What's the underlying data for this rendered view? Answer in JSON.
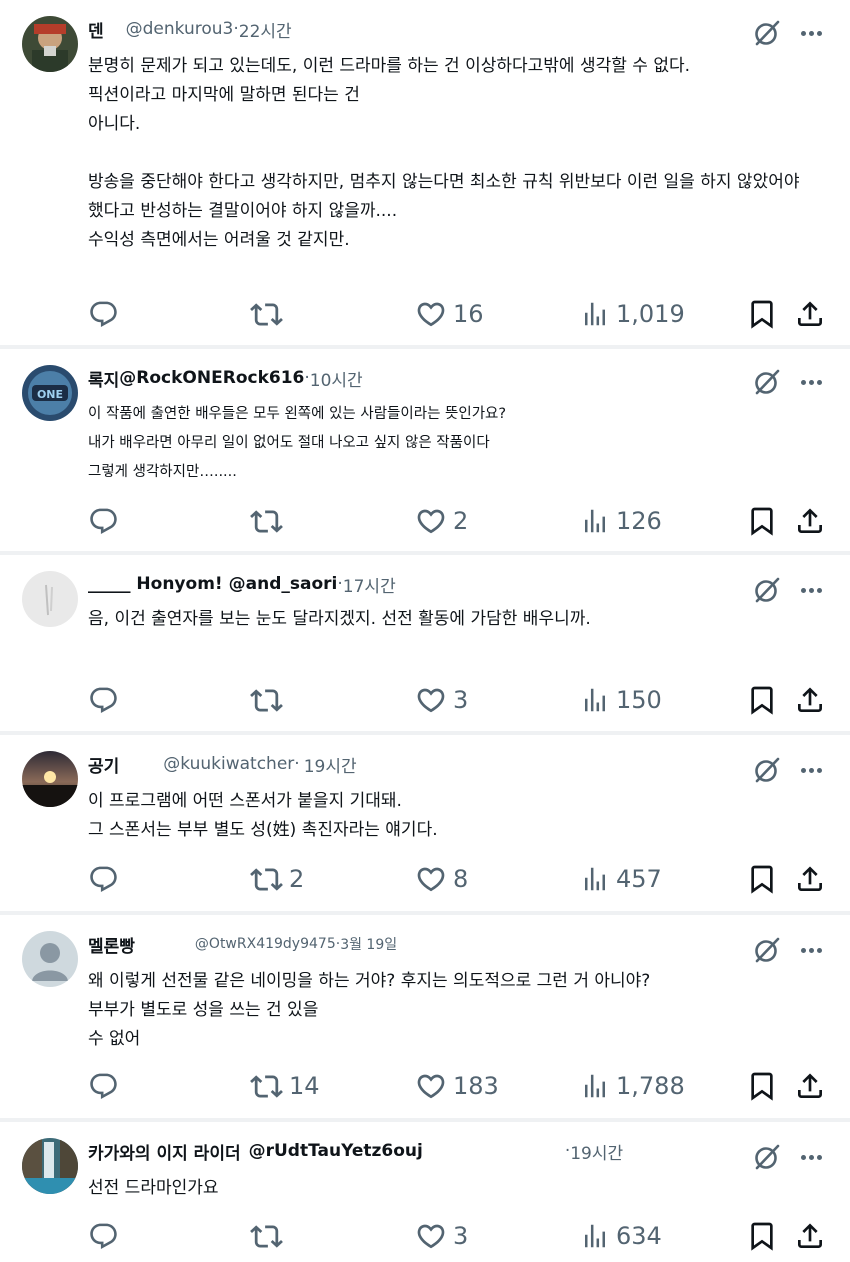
{
  "tweets": [
    {
      "name": "덴",
      "handle": "@denkurou3",
      "time": "22시간",
      "text": "분명히 문제가 되고 있는데도, 이런 드라마를 하는 건 이상하다고밖에 생각할 수 없다.\n픽션이라고 마지막에 말하면 된다는 건\n아니다.\n\n방송을 중단해야 한다고 생각하지만, 멈추지 않는다면 최소한 규칙 위반보다 이런 일을 하지 않았어야\n했다고 반성하는 결말이어야 하지 않을까....\n수익성 측면에서는 어려울 것 같지만.",
      "reply": "",
      "retweet": "",
      "like": "16",
      "views": "1,019",
      "avatar": "photo-person"
    },
    {
      "name": "록지",
      "handle": "@RockONERock616",
      "time": "10시간",
      "text": "이 작품에 출연한 배우들은 모두 왼쪽에 있는 사람들이라는 뜻인가요?\n내가 배우라면 아무리 일이 없어도 절대 나오고 싶지 않은 작품이다\n그렇게 생각하지만….....",
      "reply": "",
      "retweet": "",
      "like": "2",
      "views": "126",
      "avatar": "logo-badge"
    },
    {
      "name": "_____ Honyom!",
      "handle": "@and_saori",
      "time": "17시간",
      "text": "음, 이건 출연자를 보는 눈도 달라지겠지. 선전 활동에 가담한 배우니까.",
      "reply": "",
      "retweet": "",
      "like": "3",
      "views": "150",
      "avatar": "gray-sketch"
    },
    {
      "name": "공기",
      "handle": "@kuukiwatcher",
      "time": "19시간",
      "text": "이 프로그램에 어떤 스폰서가 붙을지 기대돼.\n그 스폰서는 부부 별도 성(姓) 촉진자라는 얘기다.",
      "reply": "",
      "retweet": "2",
      "like": "8",
      "views": "457",
      "avatar": "sunset"
    },
    {
      "name": "멜론빵",
      "handle": "@OtwRX419dy9475",
      "time": "3월 19일",
      "text": "왜 이렇게 선전물 같은 네이밍을 하는 거야? 후지는 의도적으로 그런 거 아니야?\n부부가 별도로 성을 쓰는 건 있을\n수 없어",
      "reply": "",
      "retweet": "14",
      "like": "183",
      "views": "1,788",
      "avatar": "default-profile"
    },
    {
      "name": "카가와의 이지 라이더",
      "handle": "@rUdtTauYetz6ouj",
      "time": "19시간",
      "text": "선전 드라마인가요",
      "reply": "",
      "retweet": "",
      "like": "3",
      "views": "634",
      "avatar": "waterfall"
    }
  ],
  "icons": {
    "reply": "reply-icon",
    "retweet": "retweet-icon",
    "like": "heart-icon",
    "views": "views-icon",
    "bookmark": "bookmark-icon",
    "share": "share-icon",
    "mute": "grok-icon",
    "more": "more-icon"
  },
  "colors": {
    "text": "#0f1419",
    "secondary": "#536471",
    "divider": "#eff1f3"
  }
}
